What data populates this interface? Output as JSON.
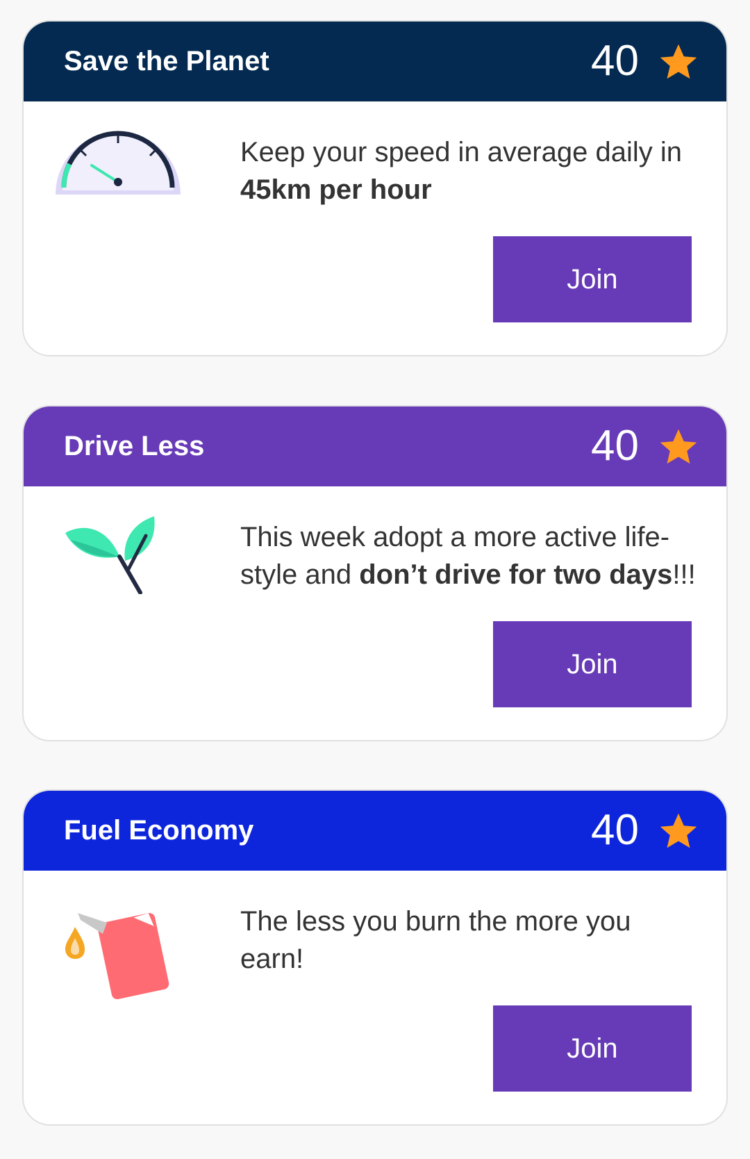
{
  "colors": {
    "save_header": "#042a52",
    "drive_header": "#673ab7",
    "fuel_header": "#0d26dc",
    "star": "#ff9a1f",
    "join_button": "#673ab7"
  },
  "cards": [
    {
      "title": "Save the Planet",
      "points": "40",
      "icon": "speedometer-icon",
      "text_pre": "Keep your speed in average daily in ",
      "text_bold": "45km per hour",
      "text_post": "",
      "button_label": "Join"
    },
    {
      "title": "Drive Less",
      "points": "40",
      "icon": "leaf-sprout-icon",
      "text_pre": "This week adopt a more active life-style and ",
      "text_bold": "don’t drive for two days",
      "text_post": "!!!",
      "button_label": "Join"
    },
    {
      "title": "Fuel Economy",
      "points": "40",
      "icon": "fuel-can-icon",
      "text_pre": "The less you burn the more you earn!",
      "text_bold": "",
      "text_post": "",
      "button_label": "Join"
    }
  ]
}
